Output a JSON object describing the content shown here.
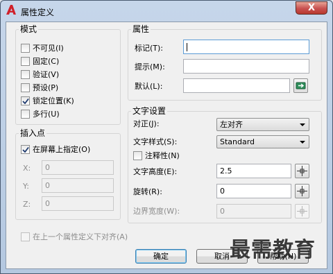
{
  "window": {
    "title": "属性定义",
    "close_label": "X"
  },
  "mode": {
    "title": "模式",
    "options": [
      {
        "label": "不可见(I)",
        "checked": false
      },
      {
        "label": "固定(C)",
        "checked": false
      },
      {
        "label": "验证(V)",
        "checked": false
      },
      {
        "label": "预设(P)",
        "checked": false
      },
      {
        "label": "锁定位置(K)",
        "checked": true
      },
      {
        "label": "多行(U)",
        "checked": false
      }
    ]
  },
  "insertion": {
    "title": "插入点",
    "on_screen_label": "在屏幕上指定(O)",
    "on_screen_checked": true,
    "x_label": "X:",
    "x_value": "0",
    "y_label": "Y:",
    "y_value": "0",
    "z_label": "Z:",
    "z_value": "0"
  },
  "attribute": {
    "title": "属性",
    "tag_label": "标记(T):",
    "tag_value": "",
    "prompt_label": "提示(M):",
    "prompt_value": "",
    "default_label": "默认(L):",
    "default_value": ""
  },
  "text_settings": {
    "title": "文字设置",
    "justify_label": "对正(J):",
    "justify_value": "左对齐",
    "style_label": "文字样式(S):",
    "style_value": "Standard",
    "annotative_label": "注释性(N)",
    "annotative_checked": false,
    "height_label": "文字高度(E):",
    "height_value": "2.5",
    "rotation_label": "旋转(R):",
    "rotation_value": "0",
    "boundary_label": "边界宽度(W):",
    "boundary_value": "0"
  },
  "align_below_label": "在上一个属性定义下对齐(A)",
  "buttons": {
    "ok": "确定",
    "cancel": "取消",
    "help": "帮助(H)"
  },
  "watermark": "最需教育",
  "colors": {
    "accent": "#c0392b",
    "titlebar": "#c6d6ea",
    "dialog_bg": "#f0f0f0"
  }
}
